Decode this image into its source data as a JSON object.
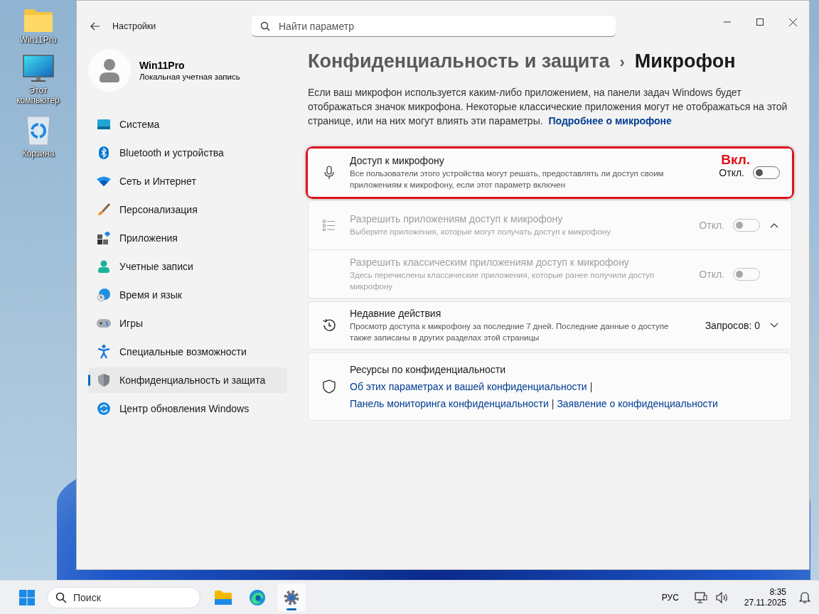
{
  "desktop_icons": [
    {
      "label": "Win11Pro"
    },
    {
      "label": "Этот компьютер"
    },
    {
      "label": "Корзина"
    }
  ],
  "window": {
    "title": "Настройки",
    "search": {
      "placeholder": "Найти параметр"
    }
  },
  "account": {
    "name": "Win11Pro",
    "type": "Локальная учетная запись"
  },
  "sidebar": {
    "items": [
      {
        "label": "Система",
        "selected": false
      },
      {
        "label": "Bluetooth и устройства",
        "selected": false
      },
      {
        "label": "Сеть и Интернет",
        "selected": false
      },
      {
        "label": "Персонализация",
        "selected": false
      },
      {
        "label": "Приложения",
        "selected": false
      },
      {
        "label": "Учетные записи",
        "selected": false
      },
      {
        "label": "Время и язык",
        "selected": false
      },
      {
        "label": "Игры",
        "selected": false
      },
      {
        "label": "Специальные возможности",
        "selected": false
      },
      {
        "label": "Конфиденциальность и защита",
        "selected": true
      },
      {
        "label": "Центр обновления Windows",
        "selected": false
      }
    ]
  },
  "breadcrumb": {
    "separator": "›",
    "parent": "Конфиденциальность и защита",
    "current": "Микрофон"
  },
  "description": {
    "text": "Если ваш микрофон используется каким-либо приложением, на панели задач Windows будет отображаться значок микрофона. Некоторые классические приложения могут не отображаться на этой странице, или на них могут влиять эти параметры.",
    "link": "Подробнее о микрофоне"
  },
  "settings": [
    {
      "kind": "toggle",
      "title": "Доступ к микрофону",
      "description": "Все пользователи этого устройства могут решать, предоставлять ли доступ своим приложениям к микрофону, если этот параметр включен",
      "toggle_label": "Откл.",
      "on": false,
      "disabled": false,
      "callout": "Вкл."
    },
    {
      "kind": "group",
      "title": "Разрешить приложениям доступ к микрофону",
      "description": "Выберите приложения, которые могут получать доступ к микрофону",
      "toggle_label": "Откл.",
      "on": false,
      "disabled": true,
      "expanded": true,
      "children": [
        {
          "title": "Разрешить классическим приложениям доступ к микрофону",
          "description": "Здесь перечислены классические приложения, которые ранее получили доступ микрофону",
          "toggle_label": "Откл.",
          "on": false,
          "disabled": true
        }
      ]
    },
    {
      "kind": "expander",
      "title": "Недавние действия",
      "description": "Просмотр доступа к микрофону за последние 7 дней. Последние данные о доступе также записаны в других разделах этой страницы",
      "value": "Запросов: 0",
      "expanded": false
    },
    {
      "kind": "links",
      "title": "Ресурсы по конфиденциальности",
      "separator": "|",
      "link_lines": [
        [
          "Об этих параметрах и вашей конфиденциальности"
        ],
        [
          "Панель мониторинга конфиденциальности",
          "Заявление о конфиденциальности"
        ]
      ]
    }
  ],
  "taskbar": {
    "search": {
      "placeholder": "Поиск"
    },
    "apps": [
      {
        "selected": false
      },
      {
        "selected": false
      },
      {
        "selected": true
      }
    ],
    "language": "РУС",
    "time": "8:35",
    "date": "27.11.2025"
  }
}
